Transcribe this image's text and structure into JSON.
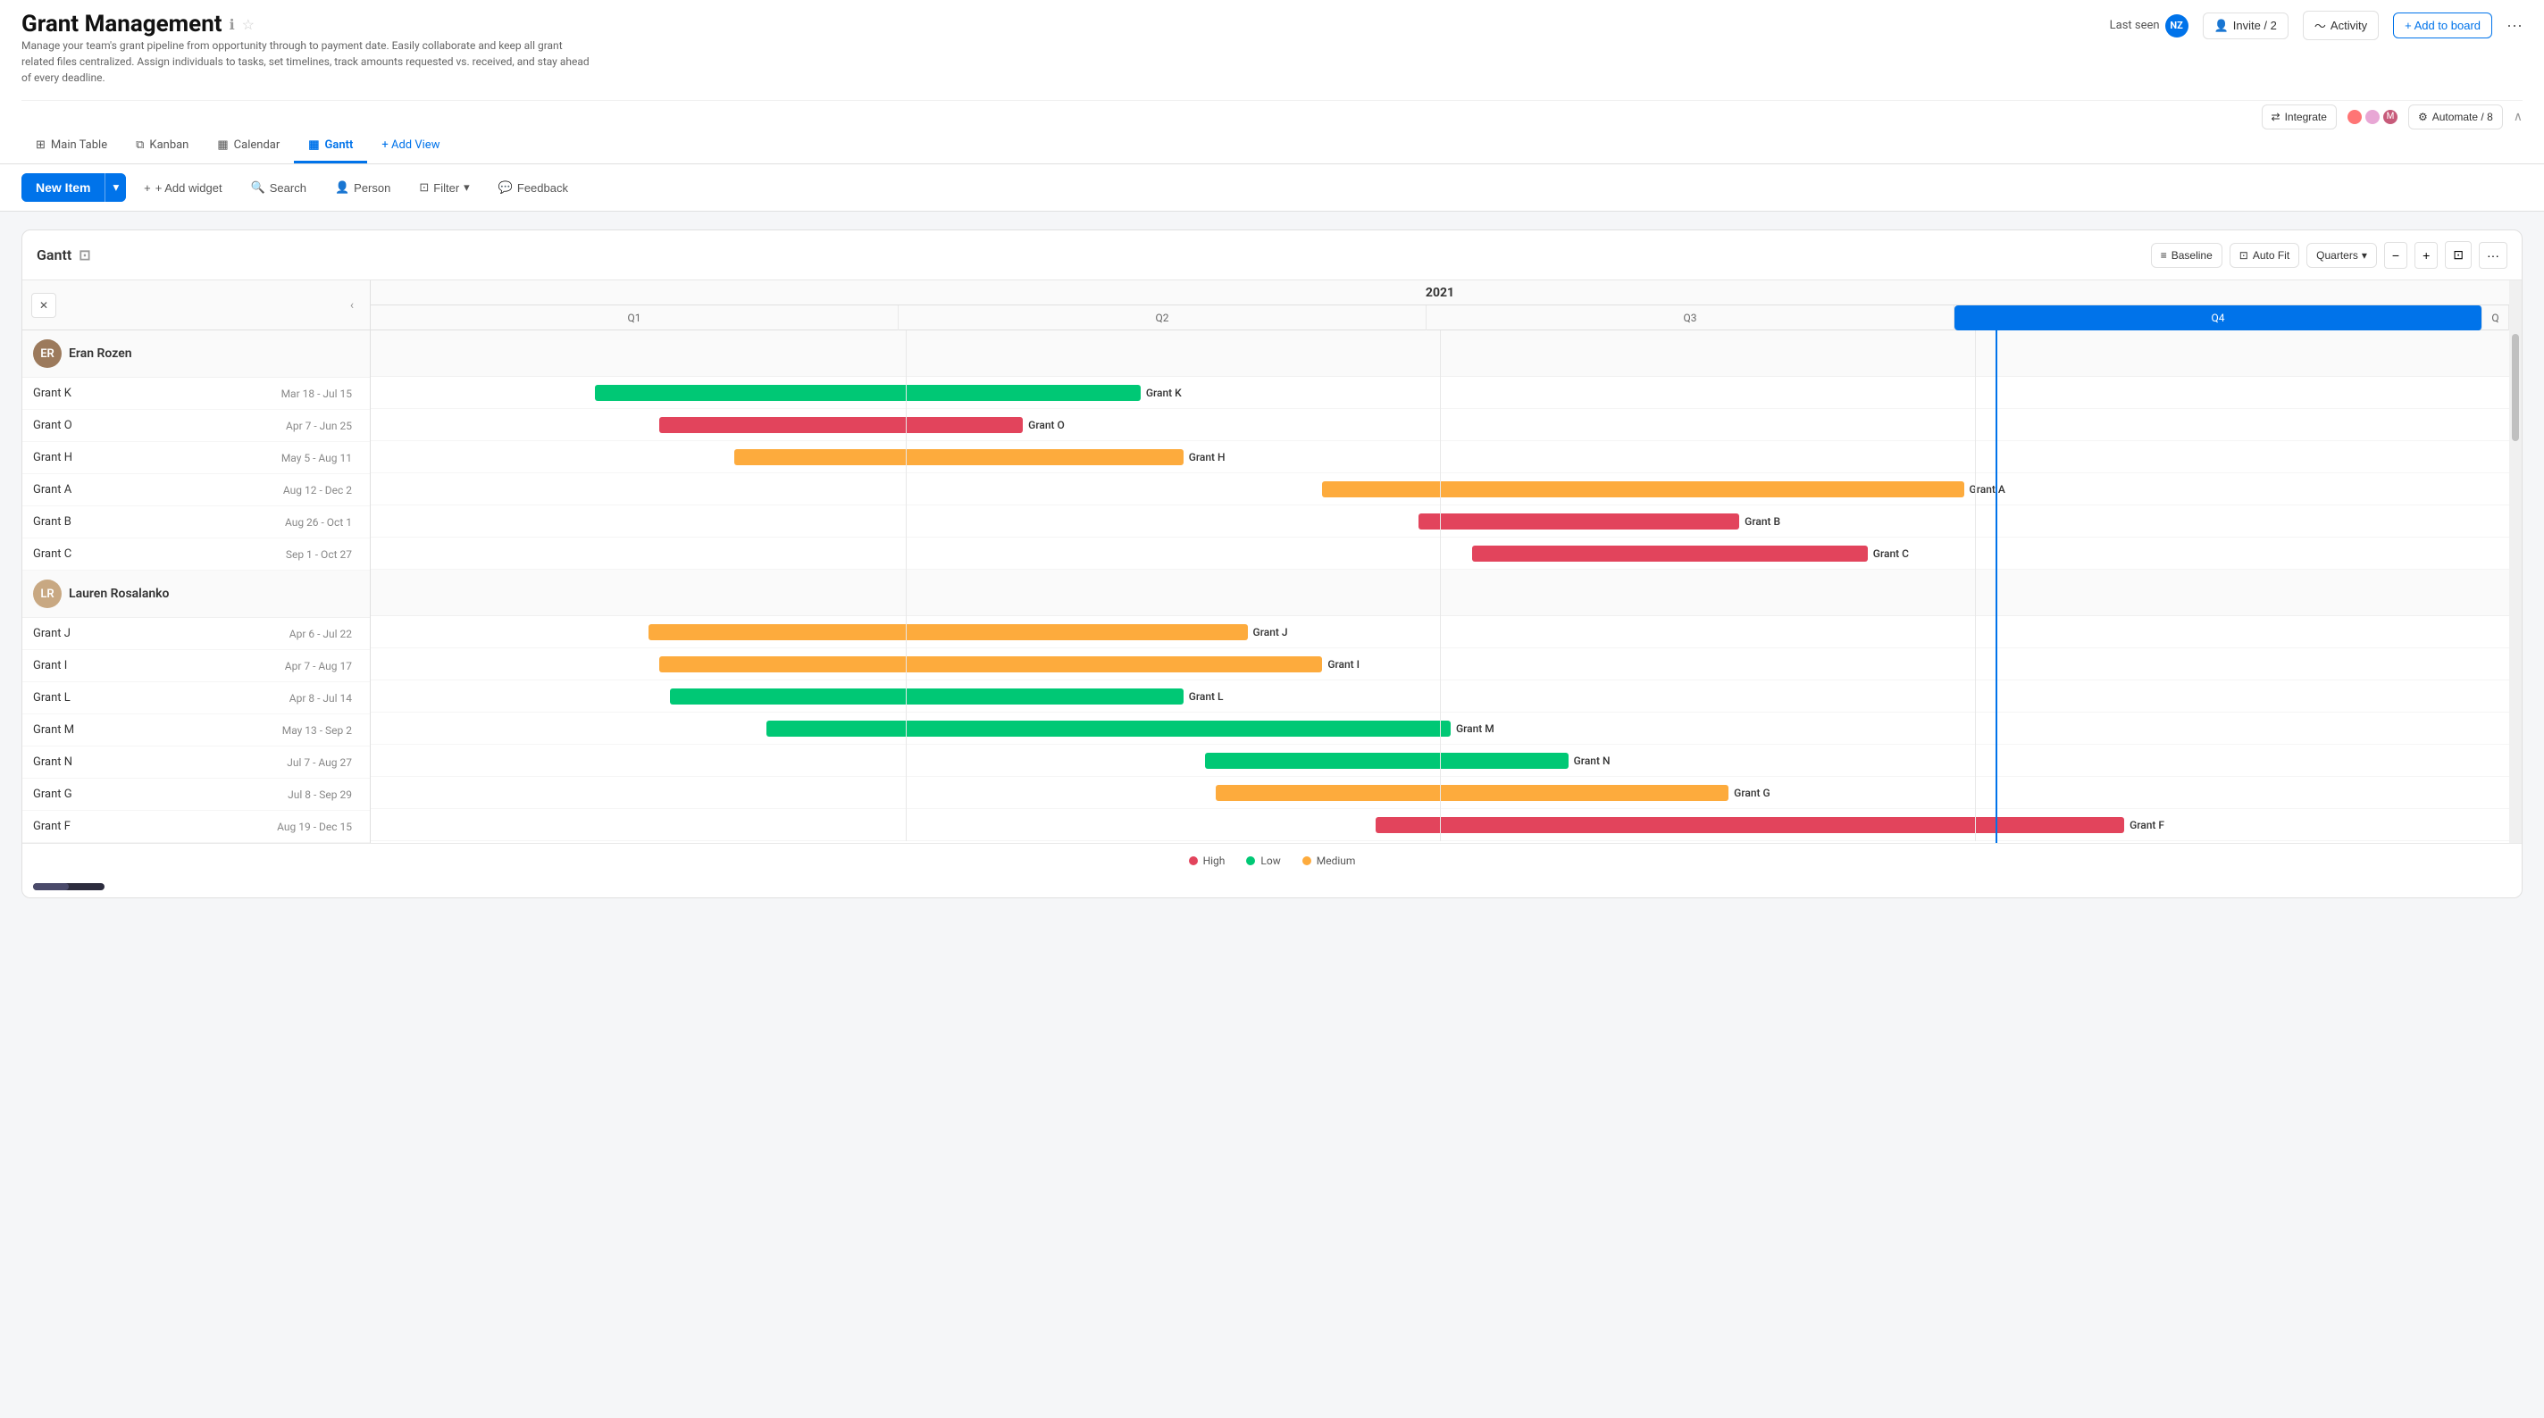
{
  "app": {
    "title": "Grant Management",
    "description": "Manage your team's grant pipeline from opportunity through to payment date. Easily collaborate and keep all grant related files centralized. Assign individuals to tasks, set timelines, track amounts requested vs. received, and stay ahead of every deadline.",
    "last_seen_label": "Last seen",
    "invite_label": "Invite / 2",
    "activity_label": "Activity",
    "add_to_board_label": "+ Add to board",
    "more_icon": "···"
  },
  "nav_tabs": [
    {
      "id": "main-table",
      "label": "Main Table",
      "icon": "⊞"
    },
    {
      "id": "kanban",
      "label": "Kanban",
      "icon": "⧉"
    },
    {
      "id": "calendar",
      "label": "Calendar",
      "icon": "📅"
    },
    {
      "id": "gantt",
      "label": "Gantt",
      "icon": "▦",
      "active": true
    },
    {
      "id": "add-view",
      "label": "+ Add View",
      "icon": ""
    }
  ],
  "toolbar": {
    "new_item_label": "New Item",
    "add_widget_label": "+ Add widget",
    "search_label": "Search",
    "person_label": "Person",
    "filter_label": "Filter",
    "feedback_label": "Feedback"
  },
  "integrate_bar": {
    "integrate_label": "Integrate",
    "automate_label": "Automate / 8"
  },
  "gantt": {
    "title": "Gantt",
    "baseline_label": "Baseline",
    "auto_fit_label": "Auto Fit",
    "quarters_label": "Quarters",
    "year": "2021",
    "quarters": [
      "Q1",
      "Q2",
      "Q3",
      "Q4"
    ],
    "today_line_position_percent": 76
  },
  "persons": [
    {
      "id": "eran",
      "name": "Eran Rozen",
      "avatar_initials": "ER",
      "avatar_color": "#9c7a5c",
      "grants": [
        {
          "name": "Grant K",
          "date": "Mar 18 - Jul 15",
          "color": "#00c875",
          "start": 10.5,
          "width": 25.5
        },
        {
          "name": "Grant O",
          "date": "Apr 7 - Jun 25",
          "color": "#e2445c",
          "start": 13.5,
          "width": 17
        },
        {
          "name": "Grant H",
          "date": "May 5 - Aug 11",
          "color": "#fdab3d",
          "start": 17,
          "width": 21
        },
        {
          "name": "Grant A",
          "date": "Aug 12 - Dec 2",
          "color": "#fdab3d",
          "start": 44.5,
          "width": 30
        },
        {
          "name": "Grant B",
          "date": "Aug 26 - Oct 1",
          "color": "#e2445c",
          "start": 49,
          "width": 15
        },
        {
          "name": "Grant C",
          "date": "Sep 1 - Oct 27",
          "color": "#e2445c",
          "start": 51.5,
          "width": 18.5
        }
      ]
    },
    {
      "id": "lauren",
      "name": "Lauren Rosalanko",
      "avatar_initials": "LR",
      "avatar_color": "#c8a882",
      "grants": [
        {
          "name": "Grant J",
          "date": "Apr 6 - Jul 22",
          "color": "#fdab3d",
          "start": 13,
          "width": 28
        },
        {
          "name": "Grant I",
          "date": "Apr 7 - Aug 17",
          "color": "#fdab3d",
          "start": 13.5,
          "width": 31
        },
        {
          "name": "Grant L",
          "date": "Apr 8 - Jul 14",
          "color": "#00c875",
          "start": 14,
          "width": 24
        },
        {
          "name": "Grant M",
          "date": "May 13 - Sep 2",
          "color": "#00c875",
          "start": 18.5,
          "width": 32
        },
        {
          "name": "Grant N",
          "date": "Jul 7 - Aug 27",
          "color": "#00c875",
          "start": 39,
          "width": 17
        },
        {
          "name": "Grant G",
          "date": "Jul 8 - Sep 29",
          "color": "#fdab3d",
          "start": 39.5,
          "width": 24
        },
        {
          "name": "Grant F",
          "date": "Aug 19 - Dec 15",
          "color": "#e2445c",
          "start": 47,
          "width": 35
        }
      ]
    }
  ],
  "legend": [
    {
      "label": "High",
      "color": "#e2445c"
    },
    {
      "label": "Low",
      "color": "#00c875"
    },
    {
      "label": "Medium",
      "color": "#fdab3d"
    }
  ]
}
